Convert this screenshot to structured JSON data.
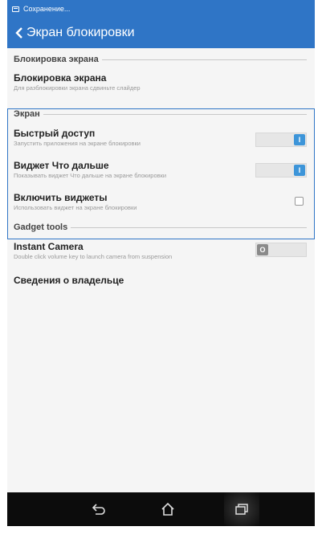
{
  "statusbar": {
    "text": "Сохранение..."
  },
  "appbar": {
    "title": "Экран блокировки"
  },
  "sections": {
    "lock_screen": "Блокировка экрана",
    "screen": "Экран",
    "gadget": "Gadget tools"
  },
  "items": {
    "lock": {
      "title": "Блокировка экрана",
      "sub": "Для разблокировки экрана сдвиньте слайдер"
    },
    "quick": {
      "title": "Быстрый доступ",
      "sub": "Запустить приложения на экране блокировки",
      "toggle": "I"
    },
    "whats_next": {
      "title": "Виджет Что дальше",
      "sub": "Показывать виджет Что дальше на экране блокировки",
      "toggle": "I"
    },
    "widgets": {
      "title": "Включить виджеты",
      "sub": "Использовать виджет на экране блокировки"
    },
    "camera": {
      "title": "Instant Camera",
      "sub": "Double click volume key to launch camera from suspension",
      "toggle": "O"
    },
    "owner": {
      "title": "Сведения о владельце"
    }
  },
  "colors": {
    "accent": "#2f75c6",
    "toggle_on": "#3d95d9",
    "toggle_off": "#8a8a8a"
  },
  "icons": [
    "notification-icon",
    "back-arrow-icon",
    "back-icon",
    "home-icon",
    "recent-apps-icon"
  ]
}
